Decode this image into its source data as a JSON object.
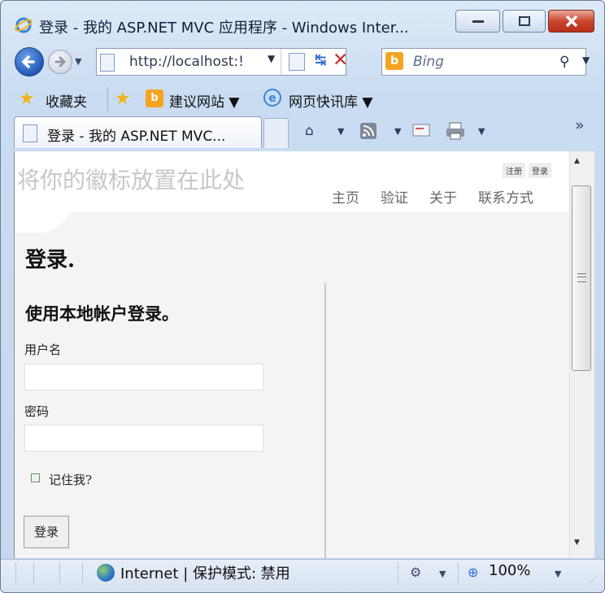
{
  "window": {
    "title": "登录 - 我的 ASP.NET MVC 应用程序 - Windows Inter...",
    "controls": {
      "minimize": "—",
      "maximize": "□",
      "close": "✕"
    }
  },
  "nav": {
    "url": "http://localhost:!",
    "search_placeholder": "Bing",
    "search_icon": "⚲",
    "dropdown": "▼",
    "refresh": "↹",
    "stop": "✕"
  },
  "favorites": {
    "label": "收藏夹",
    "suggested": "建议网站 ▼",
    "web_slice": "网页快讯库 ▼"
  },
  "tab": {
    "label": "登录 - 我的 ASP.NET MVC...",
    "overflow": "»",
    "command_icons": [
      "home-icon",
      "feeds-icon",
      "mail-icon",
      "print-icon"
    ]
  },
  "site": {
    "logo_placeholder": "将你的徽标放置在此处",
    "register_link": "注册",
    "login_link": "登录",
    "menu": [
      "主页",
      "验证",
      "关于",
      "联系方式"
    ]
  },
  "page": {
    "heading": "登录.",
    "local_heading": "使用本地帐户登录。",
    "username_label": "用户名",
    "username_value": "",
    "password_label": "密码",
    "password_value": "",
    "remember_label": "记住我?",
    "remember_checked": false,
    "submit_label": "登录"
  },
  "status": {
    "zone": "Internet | 保护模式: 禁用",
    "zoom": "100%"
  },
  "colors": {
    "chrome": "#c9dcf2",
    "close_button": "#c9462c",
    "page_background": "#f4f4f4",
    "logo_text": "#c7c7c7"
  }
}
